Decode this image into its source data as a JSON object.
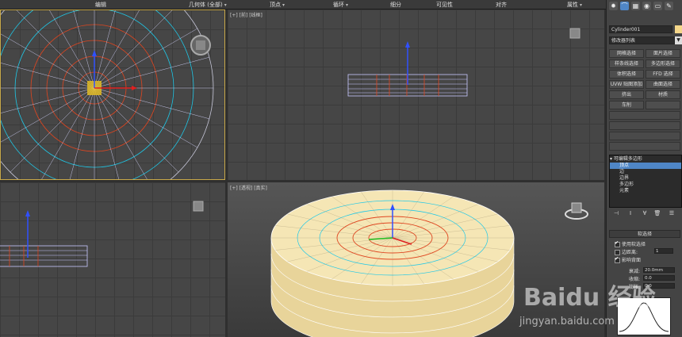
{
  "ribbon": {
    "items": [
      {
        "label": "编辑"
      },
      {
        "label": "几何体 (全部)"
      },
      {
        "label": "顶点"
      },
      {
        "label": "循环"
      },
      {
        "label": "细分"
      },
      {
        "label": "可见性"
      },
      {
        "label": "对齐"
      },
      {
        "label": "属性"
      }
    ]
  },
  "viewports": {
    "front_label": "[+] [前] [线框]",
    "persp_label": "[+] [透视] [真实]"
  },
  "command_panel": {
    "object_name": "Cylinder001",
    "object_color": "#f5d78a",
    "modifier_list": "修改器列表",
    "buttons": [
      "网格选择",
      "面片选择",
      "样条线选择",
      "多边形选择",
      "体积选择",
      "FFD 选择",
      "UVW 贴图添加",
      "曲面选择",
      "挤出",
      "材质",
      "车削"
    ],
    "stack": {
      "root": "可编辑多边形",
      "items": [
        "顶点",
        "边",
        "边界",
        "多边形",
        "元素"
      ],
      "selected": "顶点"
    },
    "soft_selection": {
      "title": "软选择",
      "use_soft": "使用软选择",
      "edge_distance": "边距离:",
      "edge_distance_value": "1",
      "affect_backfacing": "影响背面",
      "falloff_label": "衰减:",
      "falloff_value": "20.0mm",
      "pinch_label": "收缩:",
      "pinch_value": "0.0",
      "bubble_label": "膨胀:",
      "bubble_value": "0.0"
    }
  },
  "watermark": {
    "brand": "Baidu 经验",
    "url": "jingyan.baidu.com"
  },
  "colors": {
    "selected_edge": "#e0451f",
    "vertex_cyan": "#1ec8e8",
    "cylinder": "#f2e2aa",
    "accent": "#4f86c6"
  }
}
